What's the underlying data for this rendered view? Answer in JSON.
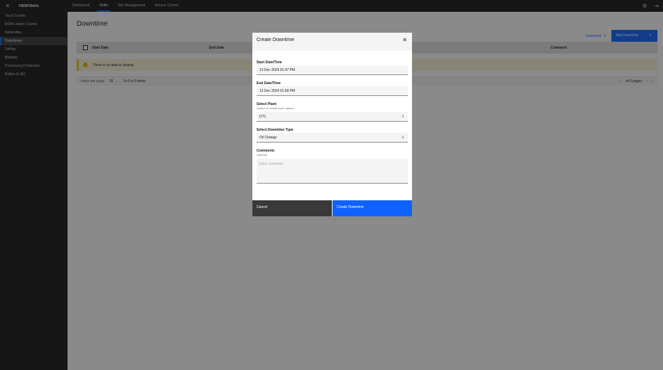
{
  "header": {
    "brand": "FBSPIAfrIe",
    "nav": [
      "Dashboard",
      "Shifts",
      "Site Management",
      "Access Control"
    ],
    "active_nav": "Shifts"
  },
  "sidebar": {
    "items": [
      {
        "label": "Truck Counts"
      },
      {
        "label": "ROM Loader Counts"
      },
      {
        "label": "Rehandles"
      },
      {
        "label": "Downtimes"
      },
      {
        "label": "Drilling"
      },
      {
        "label": "Blasting"
      },
      {
        "label": "Processing Production"
      },
      {
        "label": "Bullion & GIC"
      }
    ],
    "active": "Downtimes"
  },
  "main": {
    "title": "Downtime",
    "download_label": "Download",
    "add_label": "Add Downtime",
    "table": {
      "columns": [
        "Start Date",
        "End Date",
        "Comment"
      ]
    },
    "empty_notice": "There is no data to display.",
    "pagination": {
      "items_per_page_label": "Items per page:",
      "items_per_page": "20",
      "range": "0–0 of 0 items",
      "pages": "of 0 pages"
    }
  },
  "modal": {
    "title": "Create Downtime",
    "start_label": "Start Date/Time",
    "start_value": "13 Dec 2024 01:47 PM",
    "end_label": "End Date/Time",
    "end_value": "13 Dec 2024 01:68 PM",
    "plant_label": "Select Plant",
    "plant_helper": "Search to reveal more options",
    "plant_value": "DT1",
    "type_label": "Select Downtime Type",
    "type_value": "Oil Change",
    "comments_label": "Comments",
    "comments_helper": "Optional",
    "comments_placeholder": "Enter comment",
    "cancel_label": "Cancel",
    "create_label": "Create Downtime"
  },
  "colors": {
    "primary": "#0f62fe",
    "shell": "#161616",
    "warning": "#f1c21b"
  }
}
